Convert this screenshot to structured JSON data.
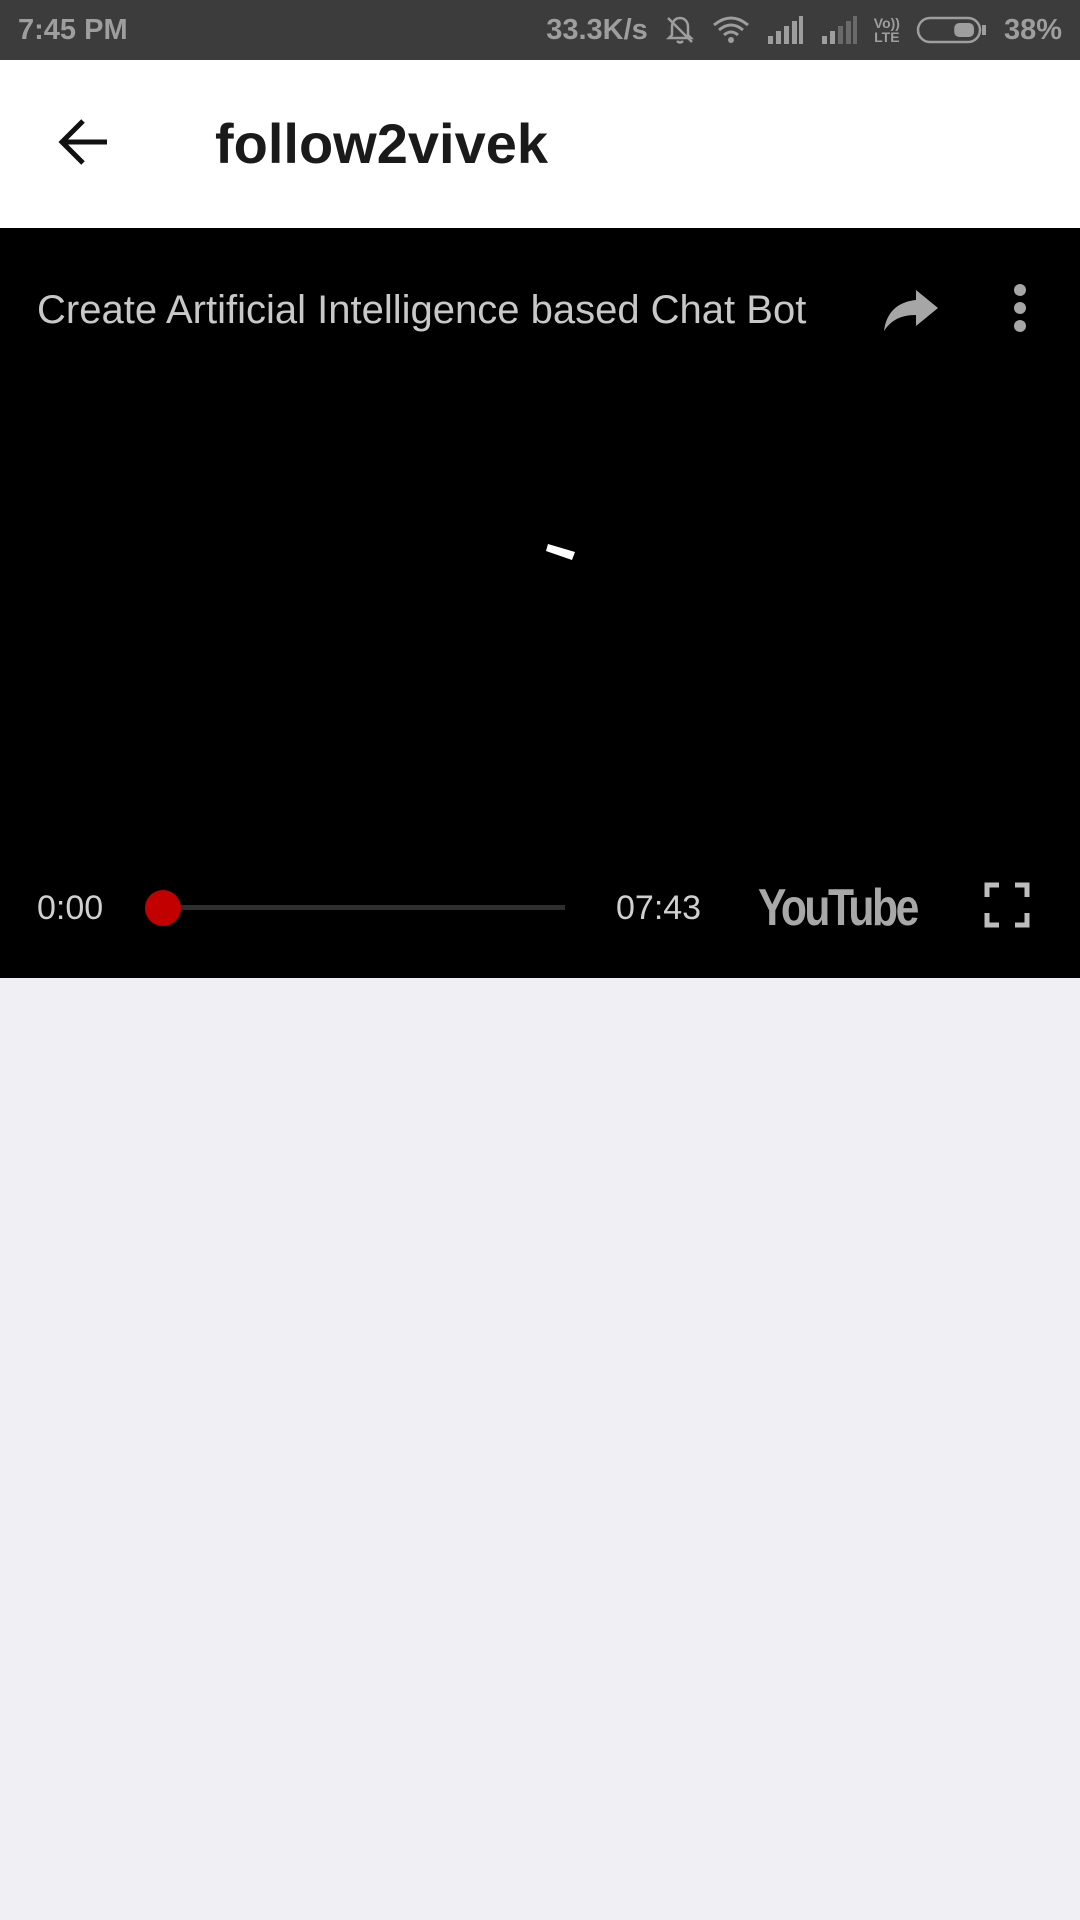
{
  "status_bar": {
    "time": "7:45 PM",
    "network_speed": "33.3K/s",
    "battery_percent": "38%",
    "battery_level": 0.38,
    "icons": [
      "bell-muted-icon",
      "wifi-icon",
      "signal-icon",
      "signal-weak-icon",
      "volte-icon",
      "battery-icon"
    ],
    "volte_label_top": "Vo))",
    "volte_label_bottom": "LTE"
  },
  "app_bar": {
    "title": "follow2vivek",
    "back_icon": "arrow-left-icon"
  },
  "player": {
    "video_title": "Create Artificial Intelligence based Chat Bot",
    "current_time": "0:00",
    "duration": "07:43",
    "progress": 0.0,
    "logo_text": "YouTube",
    "icons": [
      "share-icon",
      "more-vert-icon",
      "fullscreen-icon",
      "loading-spinner-icon"
    ],
    "colors": {
      "background": "#000000",
      "seek_thumb": "#c20000",
      "text": "#c8c8c8"
    }
  },
  "colors": {
    "status_bar": "#3c3c3c",
    "app_bar": "#ffffff",
    "page_background": "#efeff4"
  }
}
